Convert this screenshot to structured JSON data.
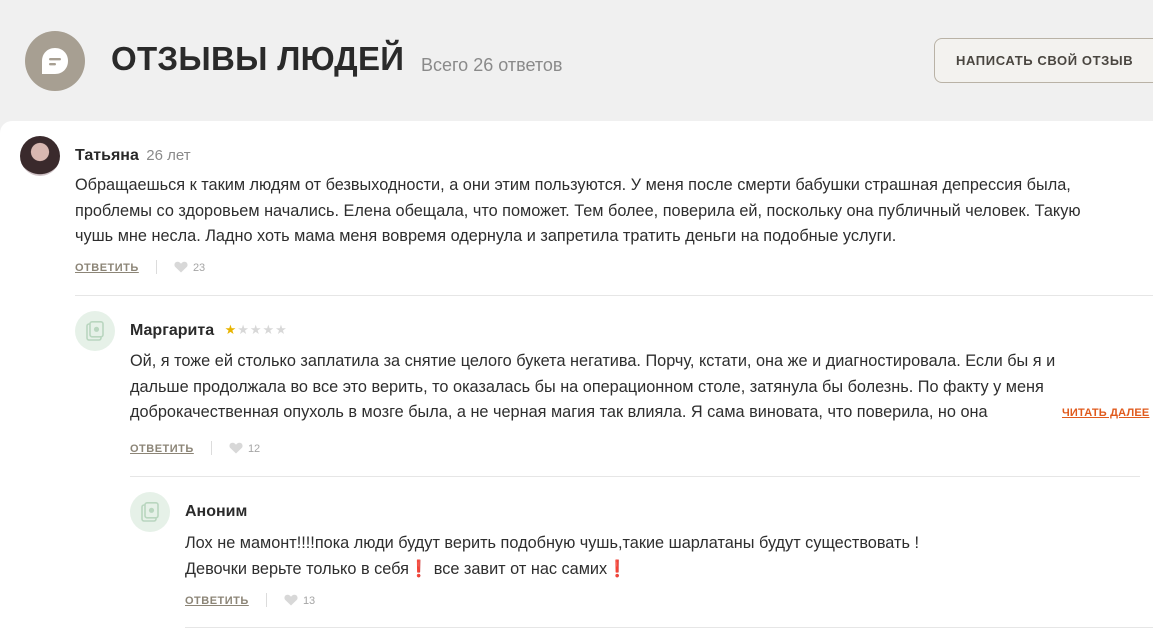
{
  "header": {
    "title": "ОТЗЫВЫ ЛЮДЕЙ",
    "count": "Всего 26 ответов",
    "write_button": "НАПИСАТЬ СВОЙ ОТЗЫВ",
    "icon": "speech-bubble-icon"
  },
  "comments": [
    {
      "name": "Татьяна",
      "age": "26 лет",
      "lines": [
        "Обращаешься к таким людям от безвыходности, а они этим пользуются. У меня после смерти бабушки страшная депрессия была,",
        "проблемы со здоровьем начались. Елена обещала, что поможет. Тем более, поверила ей, поскольку она публичный человек. Такую",
        "чушь мне несла. Ладно хоть мама меня вовремя одернула и запретила тратить деньги на подобные услуги."
      ],
      "reply_label": "ОТВЕТИТЬ",
      "likes": "23"
    },
    {
      "name": "Маргарита",
      "rating": 1,
      "rating_max": 5,
      "lines": [
        "Ой, я тоже ей столько заплатила за снятие целого букета негатива. Порчу, кстати, она же и диагностировала. Если бы я и",
        "дальше продолжала во все это верить, то оказалась бы на операционном столе, затянула бы болезнь. По факту у меня",
        "доброкачественная опухоль в мозге была, а не черная магия так влияла. Я сама виновата, что поверила, но она"
      ],
      "read_more": "ЧИТАТЬ ДАЛЕЕ",
      "reply_label": "ОТВЕТИТЬ",
      "likes": "12"
    },
    {
      "name": "Аноним",
      "line1": "Лох не мамонт!!!!пока люди будут верить подобную чушь,такие шарлатаны будут существовать !",
      "line2a": "Девочки верьте только в себя",
      "line2b": " все завит от нас самих",
      "exclamation": "❗",
      "reply_label": "ОТВЕТИТЬ",
      "likes": "13"
    }
  ],
  "colors": {
    "accent": "#a79f92",
    "read_more": "#e05a1c",
    "star": "#e8b400"
  }
}
